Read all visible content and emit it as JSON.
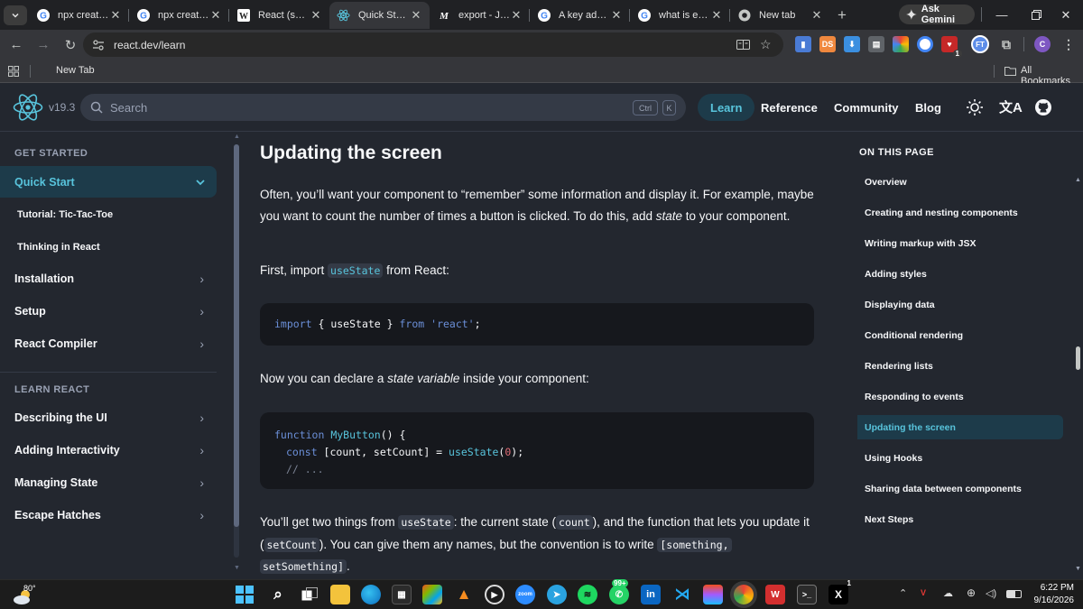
{
  "browser": {
    "tabs": [
      {
        "title": "npx create-re",
        "icon": "google-icon"
      },
      {
        "title": "npx create-re",
        "icon": "google-icon"
      },
      {
        "title": "React (softwa",
        "icon": "wikipedia-icon"
      },
      {
        "title": "Quick Start –",
        "icon": "react-icon",
        "active": true
      },
      {
        "title": "export - JavaS",
        "icon": "mdn-icon"
      },
      {
        "title": "A key advanta",
        "icon": "google-icon"
      },
      {
        "title": "what is expor",
        "icon": "google-icon"
      },
      {
        "title": "New tab",
        "icon": "chrome-icon"
      }
    ],
    "ask_gemini": "Ask Gemini",
    "url": "react.dev/learn",
    "profile_initials": "FT",
    "profile_letter": "C",
    "ext_ds": "DS",
    "ext_badge": "1",
    "bookmarks": {
      "new_tab": "New Tab",
      "all": "All Bookmarks"
    }
  },
  "header": {
    "version": "v19.3",
    "search_placeholder": "Search",
    "kbd_ctrl": "Ctrl",
    "kbd_k": "K",
    "nav": {
      "learn": "Learn",
      "reference": "Reference",
      "community": "Community",
      "blog": "Blog"
    }
  },
  "sidebar": {
    "get_started": "GET STARTED",
    "quick_start": "Quick Start",
    "tutorial": "Tutorial: Tic-Tac-Toe",
    "thinking": "Thinking in React",
    "installation": "Installation",
    "setup": "Setup",
    "compiler": "React Compiler",
    "learn_react": "LEARN REACT",
    "describing": "Describing the UI",
    "interactivity": "Adding Interactivity",
    "managing": "Managing State",
    "escape": "Escape Hatches"
  },
  "content": {
    "heading": "Updating the screen",
    "p1_a": "Often, you’ll want your component to “remember” some information and display it. For example, maybe you want to count the number of times a button is clicked. To do this, add ",
    "p1_em": "state",
    "p1_b": " to your component.",
    "p2_a": "First, import ",
    "p2_code": "useState",
    "p2_b": " from React:",
    "code1": {
      "import": "import",
      "brace_open": " { ",
      "name": "useState",
      "brace_close": " } ",
      "from": "from",
      "module": "'react'",
      "semi": ";"
    },
    "p3_a": "Now you can declare a ",
    "p3_em": "state variable",
    "p3_b": " inside your component:",
    "code2": {
      "function": "function",
      "fn_name": "MyButton",
      "fn_rest": "() {",
      "const": "const",
      "destructure": " [count, setCount] = ",
      "call": "useState",
      "paren_open": "(",
      "zero": "0",
      "paren_close": ");",
      "comment": "// ..."
    },
    "p4_a": "You’ll get two things from ",
    "p4_c1": "useState",
    "p4_b": ": the current state (",
    "p4_c2": "count",
    "p4_c": "), and the function that lets you update it (",
    "p4_c3": "setCount",
    "p4_d": "). You can give them any names, but the convention is to write ",
    "p4_c4": "[something,",
    "p4_c5": "setSomething]",
    "p4_e": "."
  },
  "toc": {
    "heading": "ON THIS PAGE",
    "items": [
      "Overview",
      "Creating and nesting components",
      "Writing markup with JSX",
      "Adding styles",
      "Displaying data",
      "Conditional rendering",
      "Rendering lists",
      "Responding to events",
      "Updating the screen",
      "Using Hooks",
      "Sharing data between components",
      "Next Steps"
    ],
    "active_index": 8
  },
  "taskbar": {
    "weather": "80°",
    "badge_whatsapp": "99+",
    "badge_x": "1",
    "time": "6:22 PM",
    "date": "9/16/2026"
  },
  "colors": {
    "accent": "#58c4dc",
    "bg": "#23272f",
    "active_bg": "#1d3b4a"
  }
}
